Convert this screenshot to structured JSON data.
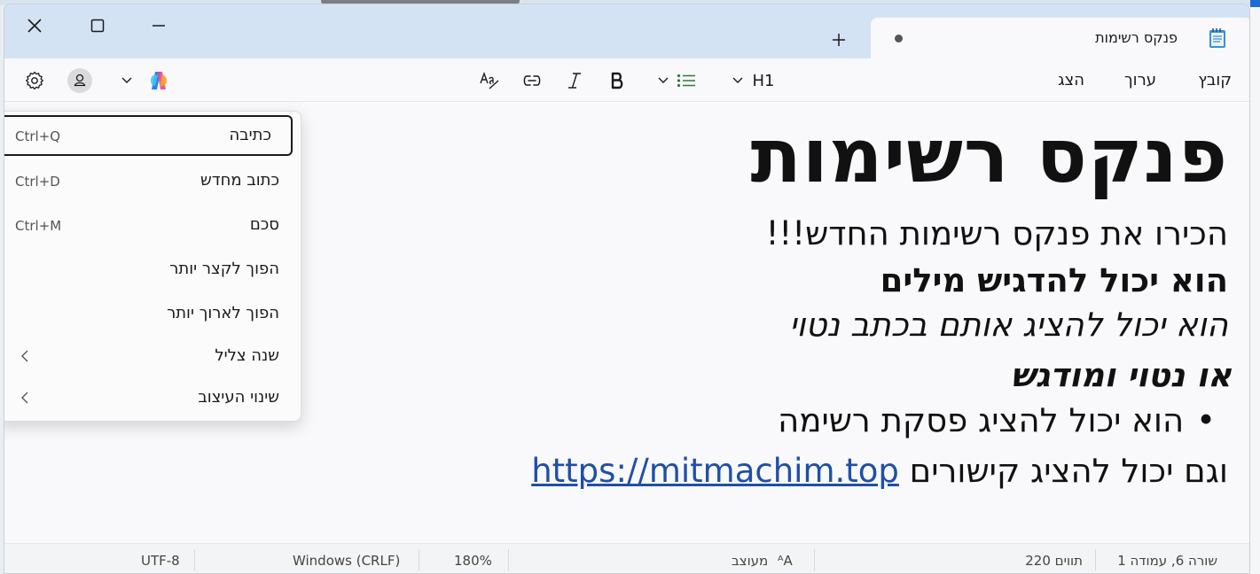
{
  "window": {
    "tab_title": "פנקס רשימות",
    "tab_icon": "notepad-icon",
    "new_tab_icon": "plus-icon"
  },
  "menu": {
    "file": "קובץ",
    "edit": "ערוך",
    "view": "הצג"
  },
  "toolbar": {
    "heading_label": "H1",
    "heading_icon": "heading-dropdown",
    "list_icon": "bulleted-list-icon",
    "bold_icon": "bold-icon",
    "italic_icon": "italic-icon",
    "link_icon": "link-icon",
    "clear_format_icon": "clear-formatting-icon",
    "copilot_icon": "copilot-icon",
    "account_icon": "account-icon",
    "settings_icon": "gear-icon",
    "accent_color": "#2b7a3d"
  },
  "document": {
    "heading": "פנקס רשימות",
    "line2": "הכירו את פנקס רשימות החדש!!!",
    "line3": "הוא יכול להדגיש מילים",
    "line4": "הוא יכול להציג אותם בכתב נטוי",
    "line5": "או נטוי ומודגש",
    "bullet_char": "•",
    "bullet_text": "הוא יכול להציג פסקת רשימה",
    "line7_text": "וגם יכול להציג קישורים",
    "link_text": "https://mitmachim.top",
    "link_color": "#1f4fa8"
  },
  "copilot_menu": {
    "items": [
      {
        "label": "כתיבה",
        "shortcut": "Ctrl+Q"
      },
      {
        "label": "כתוב מחדש",
        "shortcut": "Ctrl+D"
      },
      {
        "label": "סכם",
        "shortcut": "Ctrl+M"
      },
      {
        "label": "הפוך לקצר יותר",
        "shortcut": ""
      },
      {
        "label": "הפוך לארוך יותר",
        "shortcut": ""
      },
      {
        "label": "שנה צליל",
        "shortcut": ""
      },
      {
        "label": "שינוי העיצוב",
        "shortcut": ""
      }
    ]
  },
  "status": {
    "position": "שורה 6, עמודה 1",
    "chars": "220 תווים",
    "format_mode": "מעוצב",
    "zoom": "180%",
    "line_ending": "Windows (CRLF)",
    "encoding": "UTF-8"
  }
}
